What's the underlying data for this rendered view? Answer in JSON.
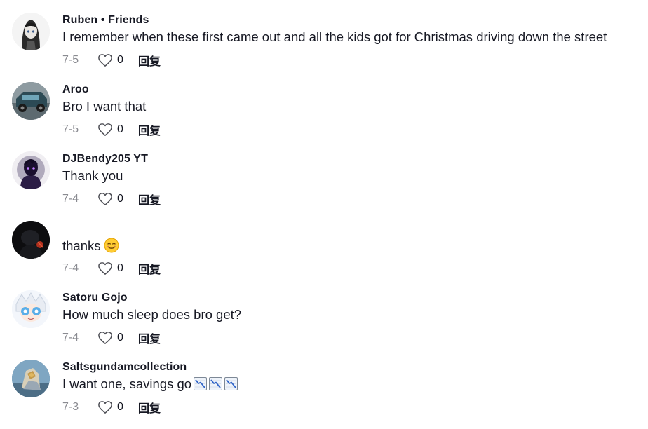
{
  "comments": [
    {
      "author": "Ruben • Friends",
      "text": "I remember when these first came out and all the kids got for Christmas driving down the street",
      "date": "7-5",
      "likes": "0",
      "reply_label": "回复"
    },
    {
      "author": "Aroo",
      "text": "Bro I want that",
      "date": "7-5",
      "likes": "0",
      "reply_label": "回复"
    },
    {
      "author": "DJBendy205 YT",
      "text": "Thank you",
      "date": "7-4",
      "likes": "0",
      "reply_label": "回复"
    },
    {
      "author": "",
      "text": "thanks",
      "date": "7-4",
      "likes": "0",
      "reply_label": "回复"
    },
    {
      "author": "Satoru Gojo",
      "text": "How much sleep does bro get?",
      "date": "7-4",
      "likes": "0",
      "reply_label": "回复"
    },
    {
      "author": "Saltsgundamcollection",
      "text": "I want one, savings go",
      "date": "7-3",
      "likes": "0",
      "reply_label": "回复"
    }
  ],
  "icons": {
    "like": "heart-outline-icon",
    "smile_emoji": "smiling-face-emoji",
    "chart_down_emoji": "chart-decreasing-emoji"
  },
  "colors": {
    "text": "#161823",
    "muted": "#8a8b91"
  }
}
